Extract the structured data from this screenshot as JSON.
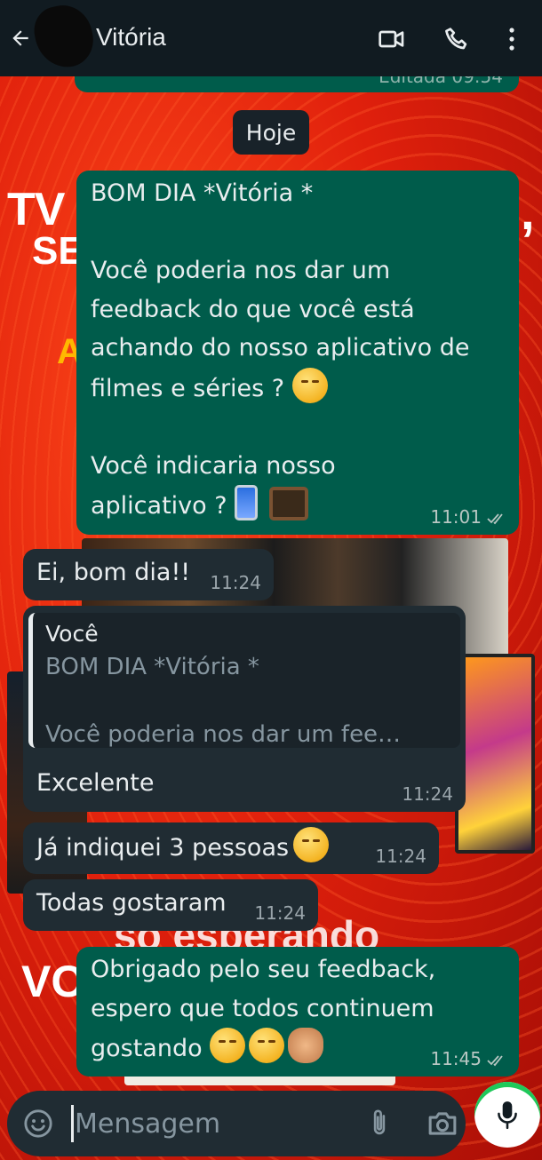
{
  "header": {
    "contact_name": "Vitória"
  },
  "chat": {
    "previous_edited_meta": "Editada 09:54",
    "date_chip": "Hoje",
    "messages": [
      {
        "direction": "outgoing",
        "lines": [
          "BOM DIA *Vitória *",
          "",
          "Você poderia nos dar um",
          "feedback do que você está",
          "achando do nosso aplicativo de",
          "filmes e séries ?"
        ],
        "lines_b": [
          "",
          "Você indicaria nosso",
          "aplicativo ?"
        ],
        "time": "11:01",
        "status": "read"
      },
      {
        "direction": "incoming",
        "text": "Ei, bom dia!!",
        "time": "11:24"
      },
      {
        "direction": "incoming",
        "quote_author": "Você",
        "quote_line1": "BOM DIA *Vitória *",
        "quote_line2": "Você poderia nos dar um fee…",
        "text": "Excelente",
        "time": "11:24"
      },
      {
        "direction": "incoming",
        "text": "Já indiquei 3 pessoas",
        "time": "11:24"
      },
      {
        "direction": "incoming",
        "text": "Todas gostaram",
        "time": "11:24"
      },
      {
        "direction": "outgoing",
        "lines": [
          "Obrigado pelo seu feedback,",
          "espero que todos continuem",
          "gostando"
        ],
        "time": "11:45",
        "status": "read"
      }
    ]
  },
  "wallpaper": {
    "text_tv": "TV",
    "text_se": "SE",
    "text_a": "A",
    "text_comma": ",",
    "text_so": "só esperando",
    "text_vo": "VO"
  },
  "composer": {
    "placeholder": "Mensagem"
  },
  "colors": {
    "header_bg": "#111b21",
    "outgoing_bubble": "#005c4b",
    "incoming_bubble": "#202c33",
    "mic_accent": "#1fc85a"
  }
}
